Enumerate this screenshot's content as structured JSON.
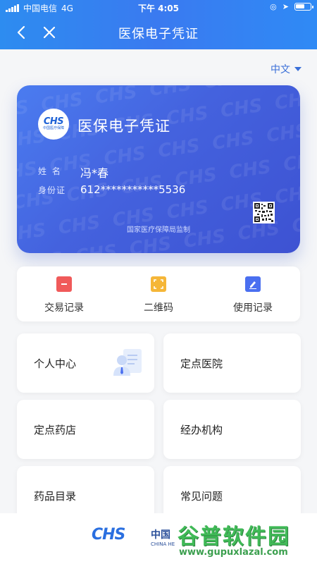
{
  "status_bar": {
    "carrier": "中国电信",
    "network": "4G",
    "time": "下午 4:05"
  },
  "nav": {
    "title": "医保电子凭证"
  },
  "language": {
    "selected": "中文"
  },
  "card": {
    "logo_text": "CHS",
    "logo_sub": "中国医疗保障",
    "title": "医保电子凭证",
    "name_label": "姓 名",
    "name_value": "冯*春",
    "id_label": "身份证",
    "id_value": "612***********5536",
    "footer": "国家医疗保障局监制"
  },
  "quick_actions": [
    {
      "label": "交易记录",
      "icon": "transaction-record-icon",
      "color": "#f05a5a"
    },
    {
      "label": "二维码",
      "icon": "qr-code-icon",
      "color": "#f5b638"
    },
    {
      "label": "使用记录",
      "icon": "usage-record-icon",
      "color": "#4a6ff0"
    }
  ],
  "tiles": [
    {
      "label": "个人中心"
    },
    {
      "label": "定点医院"
    },
    {
      "label": "定点药店"
    },
    {
      "label": "经办机构"
    },
    {
      "label": "药品目录"
    },
    {
      "label": "常见问题"
    }
  ],
  "footer": {
    "logo": "CHS",
    "org_cn": "中国",
    "org_en": "CHINA HE",
    "watermark_cn": "谷普软件园",
    "watermark_url": "www.gupuxlazal.com"
  },
  "colors": {
    "primary": "#3a7af0",
    "card": "#4462de",
    "link": "#3a6fd8"
  }
}
